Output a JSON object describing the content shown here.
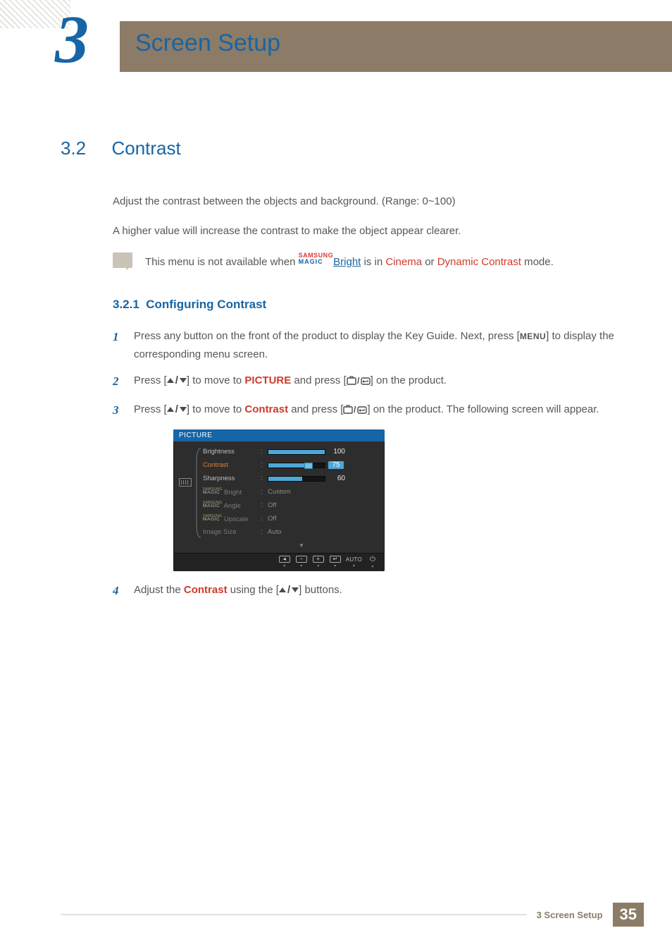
{
  "chapter": {
    "number": "3",
    "title": "Screen Setup"
  },
  "section": {
    "number": "3.2",
    "title": "Contrast"
  },
  "intro": {
    "p1": "Adjust the contrast between the objects and background. (Range: 0~100)",
    "p2": "A higher value will increase the contrast to make the object appear clearer."
  },
  "note": {
    "prefix": "This menu is not available when ",
    "magic_top": "SAMSUNG",
    "magic_bottom": "MAGIC",
    "bright": "Bright",
    "middle": " is in ",
    "cinema": "Cinema",
    "or": " or ",
    "dynamic": "Dynamic Contrast",
    "suffix": " mode."
  },
  "subsection": {
    "number": "3.2.1",
    "title": "Configuring Contrast"
  },
  "steps": {
    "s1": {
      "num": "1",
      "a": "Press any button on the front of the product to display the Key Guide. Next, press [",
      "menu": "MENU",
      "b": "] to display the corresponding menu screen."
    },
    "s2": {
      "num": "2",
      "a": "Press [",
      "b": "] to move to ",
      "picture": "PICTURE",
      "c": " and press [",
      "d": "] on the product."
    },
    "s3": {
      "num": "3",
      "a": "Press [",
      "b": "] to move to ",
      "contrast": "Contrast",
      "c": " and press [",
      "d": "] on the product. The following screen will appear."
    },
    "s4": {
      "num": "4",
      "a": "Adjust the ",
      "contrast": "Contrast",
      "b": " using the [",
      "c": "] buttons."
    }
  },
  "osd": {
    "title": "PICTURE",
    "rows": {
      "brightness": {
        "label": "Brightness",
        "value": "100",
        "fill": 100
      },
      "contrast": {
        "label": "Contrast",
        "value": "75",
        "fill": 75,
        "marker": 75
      },
      "sharpness": {
        "label": "Sharpness",
        "value": "60",
        "fill": 60
      },
      "bright": {
        "label": "Bright",
        "value": "Custom"
      },
      "angle": {
        "label": "Angle",
        "value": "Off"
      },
      "upscale": {
        "label": "Upscale",
        "value": "Off"
      },
      "imagesize": {
        "label": "Image Size",
        "value": "Auto"
      }
    },
    "footer": {
      "auto": "AUTO"
    }
  },
  "footer": {
    "text": "3 Screen Setup",
    "page": "35"
  }
}
